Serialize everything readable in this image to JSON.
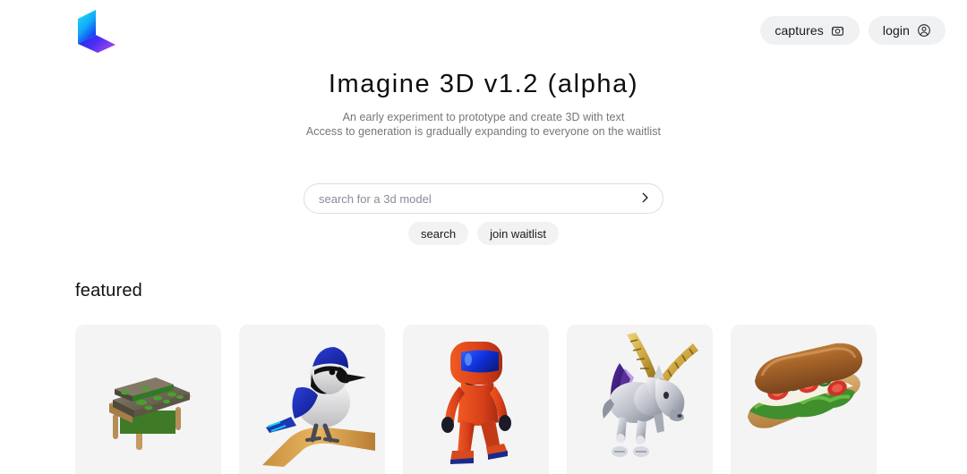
{
  "header": {
    "logo_name": "imagine-3d-logo",
    "logo_colors": {
      "top": "#1ae5f5",
      "mid": "#1736f5",
      "bottom": "#8b3bf0"
    },
    "actions": [
      {
        "label": "captures",
        "icon": "camera-icon"
      },
      {
        "label": "login",
        "icon": "account-circle-icon"
      }
    ]
  },
  "hero": {
    "title": "Imagine 3D v1.2 (alpha)",
    "subtitle_line1": "An early experiment to prototype and create 3D with text",
    "subtitle_line2": "Access to generation is gradually expanding to everyone on the waitlist"
  },
  "search": {
    "placeholder": "search for a 3d model",
    "value": "",
    "submit_icon": "chevron-right-icon"
  },
  "cta": {
    "search_label": "search",
    "waitlist_label": "join waitlist"
  },
  "featured": {
    "heading": "featured",
    "cards": [
      {
        "name": "mossy-bed",
        "alt": "Bed covered in moss and grass with wooden frame"
      },
      {
        "name": "blue-jay",
        "alt": "Blue jay bird perched on a branch"
      },
      {
        "name": "orange-astronaut",
        "alt": "Orange spacesuit figure with blue visor"
      },
      {
        "name": "unicorn",
        "alt": "Silver unicorn with golden horns and purple mane"
      },
      {
        "name": "sub-sandwich",
        "alt": "Submarine sandwich with lettuce and tomato"
      }
    ]
  },
  "colors": {
    "page_background": "#ffffff",
    "card_background": "#f4f4f4",
    "pill_background": "#eff1f3",
    "cta_background": "#f2f2f2",
    "search_border": "#dcdce6",
    "text_primary": "#111111",
    "text_muted": "#767676",
    "placeholder": "#8b8b9a"
  }
}
